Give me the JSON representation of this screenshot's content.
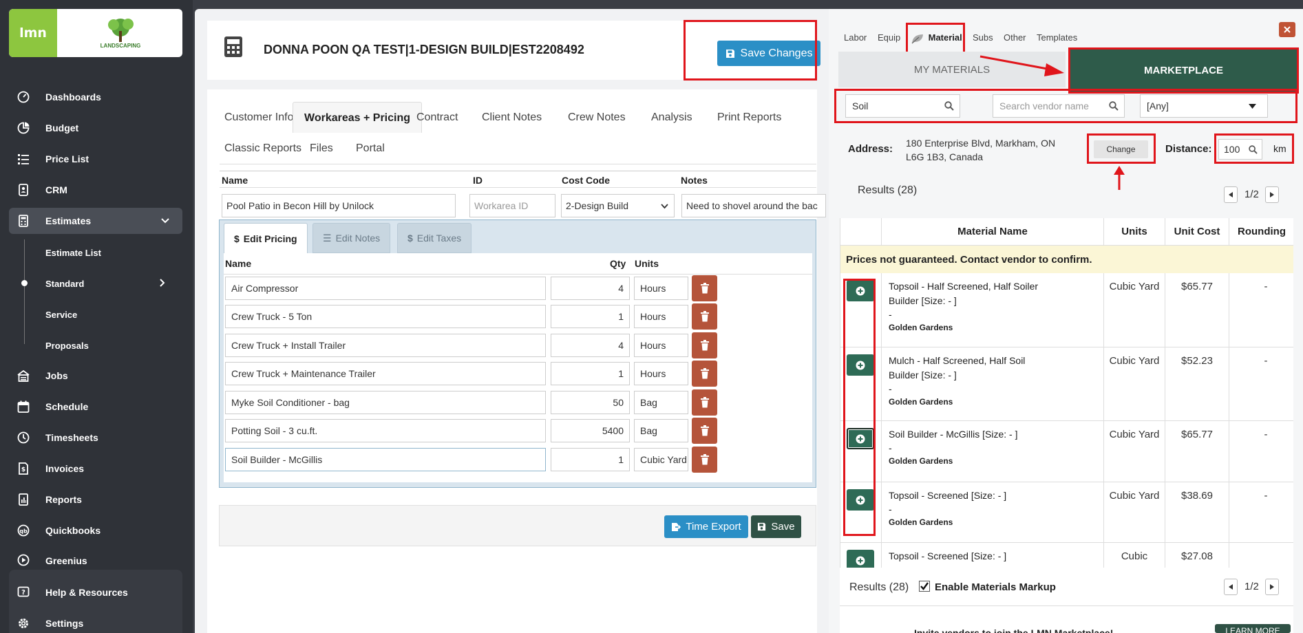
{
  "sidebar": {
    "logo_text": "lmn",
    "company_logo_text": "LANDSCAPING",
    "items": [
      {
        "label": "Dashboards",
        "icon": "dashboard-icon"
      },
      {
        "label": "Budget",
        "icon": "pie-chart-icon"
      },
      {
        "label": "Price List",
        "icon": "list-icon"
      },
      {
        "label": "CRM",
        "icon": "contact-icon"
      },
      {
        "label": "Estimates",
        "icon": "calculator-icon"
      },
      {
        "label": "Jobs",
        "icon": "jobs-icon"
      },
      {
        "label": "Schedule",
        "icon": "calendar-icon"
      },
      {
        "label": "Timesheets",
        "icon": "clock-icon"
      },
      {
        "label": "Invoices",
        "icon": "invoice-icon"
      },
      {
        "label": "Reports",
        "icon": "report-icon"
      },
      {
        "label": "Quickbooks",
        "icon": "quickbooks-icon"
      },
      {
        "label": "Greenius",
        "icon": "play-icon"
      }
    ],
    "estimates_sub": [
      "Estimate List",
      "Standard",
      "Service",
      "Proposals"
    ],
    "bottom": [
      {
        "label": "Help & Resources",
        "icon": "help-icon"
      },
      {
        "label": "Settings",
        "icon": "gear-icon"
      }
    ]
  },
  "estimate": {
    "title": "DONNA POON QA TEST|1-DESIGN BUILD|EST2208492",
    "save_changes": "Save Changes"
  },
  "tabs": [
    "Customer Info",
    "Workareas + Pricing",
    "Contract",
    "Client Notes",
    "Crew Notes",
    "Analysis",
    "Print Reports",
    "Classic Reports",
    "Files",
    "Portal"
  ],
  "workarea": {
    "headers": {
      "name": "Name",
      "id": "ID",
      "cost_code": "Cost Code",
      "notes": "Notes"
    },
    "name": "Pool Patio in Becon Hill by Unilock",
    "id_placeholder": "Workarea ID",
    "cost_code": "2-Design Build",
    "notes": "Need to shovel around the bac"
  },
  "pricing": {
    "tabs": [
      "Edit Pricing",
      "Edit Notes",
      "Edit Taxes"
    ],
    "headers": {
      "name": "Name",
      "qty": "Qty",
      "units": "Units"
    },
    "items": [
      {
        "name": "Air Compressor",
        "qty": "4",
        "units": "Hours"
      },
      {
        "name": "Crew Truck - 5 Ton",
        "qty": "1",
        "units": "Hours"
      },
      {
        "name": "Crew Truck + Install Trailer",
        "qty": "4",
        "units": "Hours"
      },
      {
        "name": "Crew Truck + Maintenance Trailer",
        "qty": "1",
        "units": "Hours"
      },
      {
        "name": "Myke Soil Conditioner - bag",
        "qty": "50",
        "units": "Bag"
      },
      {
        "name": "Potting Soil - 3 cu.ft.",
        "qty": "5400",
        "units": "Bag"
      },
      {
        "name": "Soil Builder - McGillis",
        "qty": "1",
        "units": "Cubic Yard"
      }
    ],
    "time_export": "Time Export",
    "save": "Save"
  },
  "panel": {
    "tabs": [
      "Labor",
      "Equip",
      "Material",
      "Subs",
      "Other",
      "Templates"
    ],
    "my_materials": "MY MATERIALS",
    "marketplace": "MARKETPLACE",
    "search_value": "Soil",
    "vendor_placeholder": "Search vendor name",
    "filter": "[Any]",
    "address_label": "Address:",
    "address": "180 Enterprise Blvd, Markham, ON L6G 1B3, Canada",
    "change": "Change",
    "distance_label": "Distance:",
    "distance": "100",
    "km": "km",
    "results": "Results (28)",
    "page": "1/2",
    "headers": {
      "name": "Material Name",
      "units": "Units",
      "cost": "Unit Cost",
      "rounding": "Rounding"
    },
    "notice": "Prices not guaranteed. Contact vendor to confirm.",
    "materials": [
      {
        "name": "Topsoil - Half Screened, Half Soiler Builder [Size: - ]",
        "dash": "-",
        "vendor": "Golden Gardens",
        "units": "Cubic Yard",
        "cost": "$65.77",
        "rounding": "-"
      },
      {
        "name": "Mulch - Half Screened, Half Soil Builder [Size: - ]",
        "dash": "-",
        "vendor": "Golden Gardens",
        "units": "Cubic Yard",
        "cost": "$52.23",
        "rounding": "-"
      },
      {
        "name": "Soil Builder - McGillis [Size: - ]",
        "dash": "-",
        "vendor": "Golden Gardens",
        "units": "Cubic Yard",
        "cost": "$65.77",
        "rounding": "-"
      },
      {
        "name": "Topsoil - Screened [Size: - ]",
        "dash": "-",
        "vendor": "Golden Gardens",
        "units": "Cubic Yard",
        "cost": "$38.69",
        "rounding": "-"
      },
      {
        "name": "Topsoil - Screened [Size: - ]",
        "dash": "",
        "vendor": "",
        "units": "Cubic",
        "cost": "$27.08",
        "rounding": ""
      }
    ],
    "enable_markup": "Enable Materials Markup",
    "bottom_text": "Invite vendors to join the LMN Marketplace!",
    "learn_more": "LEARN MORE"
  },
  "colors": {
    "accent_blue": "#2b8fc6",
    "marketplace_green": "#2e5b4a",
    "annotation_red": "#e0151b",
    "delete_brown": "#b5543a"
  }
}
